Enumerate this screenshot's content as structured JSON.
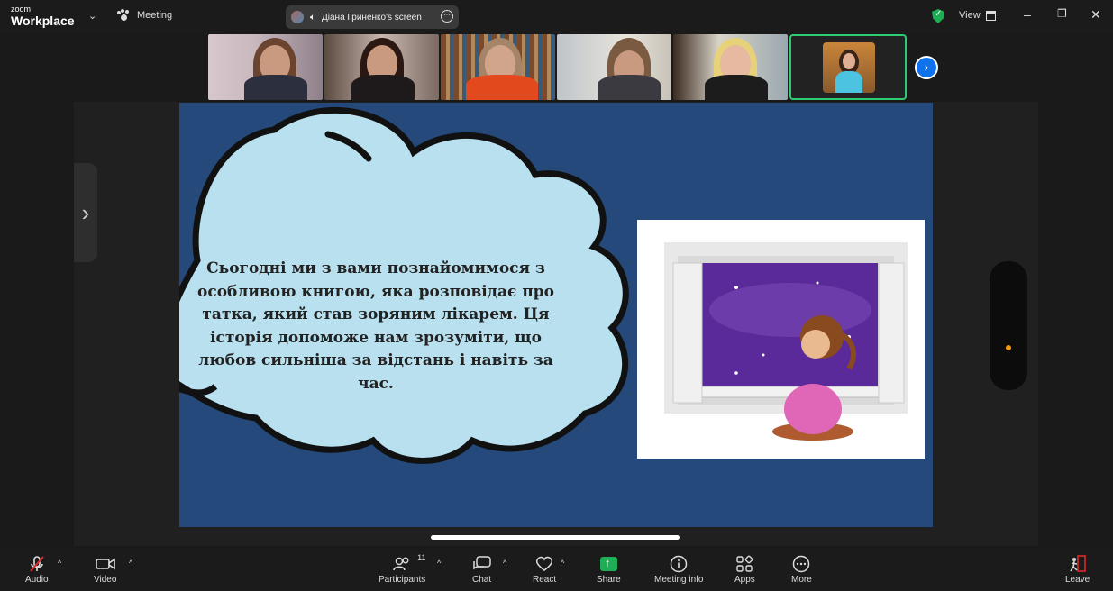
{
  "titlebar": {
    "brand_small": "zoom",
    "brand_large": "Workplace",
    "meeting_label": "Meeting",
    "screen_share_label": "Діана Гриненко's screen",
    "view_label": "View"
  },
  "participants_strip": {
    "tile_count": 6
  },
  "slide": {
    "text": "Сьогодні ми з вами познайомимося з особливою книгою, яка розповідає про татка, який став зоряним лікарем. Ця історія допоможе нам зрозуміти, що любов сильніша за відстань і навіть за час."
  },
  "toolbar": {
    "audio_label": "Audio",
    "video_label": "Video",
    "participants_label": "Participants",
    "participants_count": "11",
    "chat_label": "Chat",
    "react_label": "React",
    "share_label": "Share",
    "meeting_info_label": "Meeting info",
    "apps_label": "Apps",
    "more_label": "More",
    "leave_label": "Leave"
  },
  "colors": {
    "accent_green": "#1fae55",
    "accent_blue": "#0e72ed",
    "slide_bg": "#24497a",
    "cloud_fill": "#b9e0ef",
    "leave_red": "#e02828"
  }
}
